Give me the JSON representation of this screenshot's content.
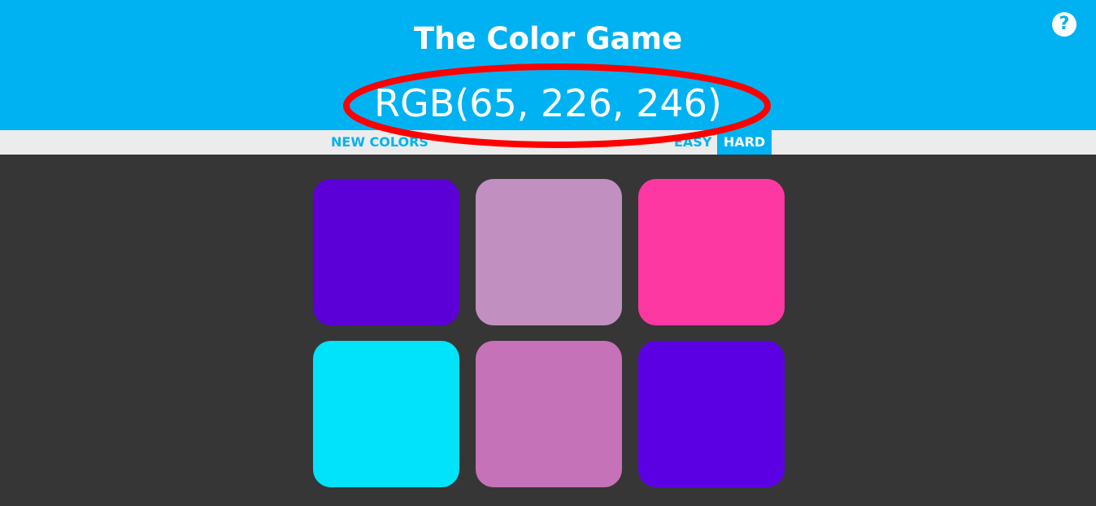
{
  "header": {
    "title": "The Color Game",
    "rgb_target": "RGB(65, 226, 246)",
    "help_glyph": "?",
    "help_icon": "question-circle-icon"
  },
  "controls": {
    "new_colors_label": "NEW COLORS",
    "easy_label": "EASY",
    "hard_label": "HARD",
    "selected_mode": "HARD"
  },
  "squares": [
    {
      "color": "#5b00d6"
    },
    {
      "color": "#c190c0"
    },
    {
      "color": "#fe38a2"
    },
    {
      "color": "#00e3fb"
    },
    {
      "color": "#c672b8"
    },
    {
      "color": "#5b00e3"
    }
  ],
  "colors": {
    "header_bg": "#00b2f2",
    "stripe_bg": "#ececec",
    "board_bg": "#363636",
    "annotation": "#ff0000"
  }
}
